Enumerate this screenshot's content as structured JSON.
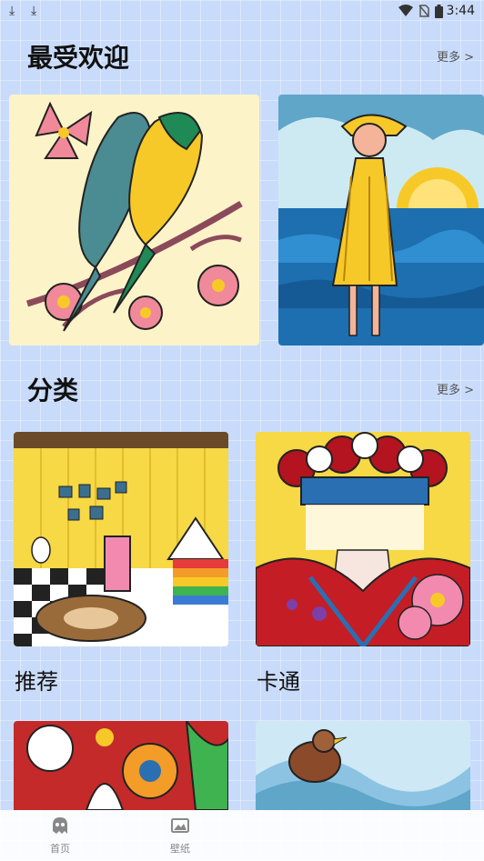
{
  "status_bar": {
    "time": "3:44"
  },
  "popular": {
    "title": "最受欢迎",
    "more": "更多 >"
  },
  "categories": {
    "title": "分类",
    "more": "更多 >",
    "items": [
      {
        "label": "推荐"
      },
      {
        "label": "卡通"
      }
    ]
  },
  "tabbar": {
    "tabs": [
      {
        "label": "首页",
        "icon": "ghost-icon"
      },
      {
        "label": "壁纸",
        "icon": "image-icon"
      }
    ]
  },
  "colors": {
    "background": "#c9dbfb",
    "accent": "#f7c928"
  }
}
